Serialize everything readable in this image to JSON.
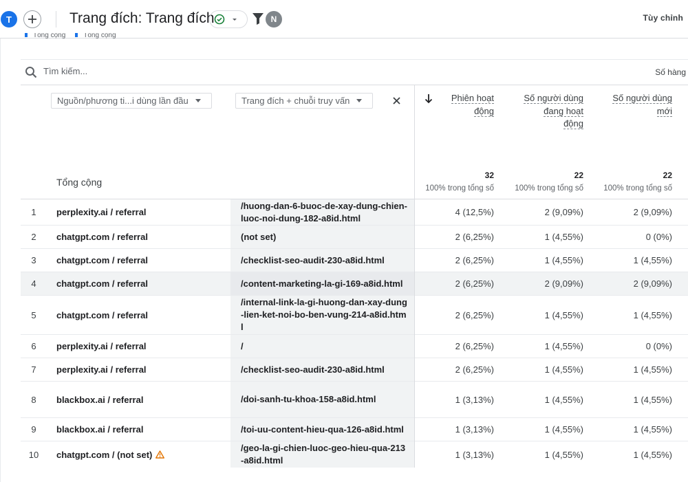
{
  "header": {
    "avatar_initial": "T",
    "title": "Trang đích: Trang đích",
    "filter_avatar_initial": "N",
    "customize_label": "Tùy chỉnh"
  },
  "legend_peek": [
    "Tổng cộng",
    "Tổng cộng"
  ],
  "search": {
    "placeholder": "Tìm kiếm...",
    "rows_label": "Số hàng"
  },
  "table": {
    "dimension_1": "Nguồn/phương ti...i dùng lần đầu",
    "dimension_2": "Trang đích + chuỗi truy vấn",
    "total_label": "Tổng cộng",
    "metrics": [
      {
        "line1": "Phiên hoạt",
        "line2": "động",
        "line3": "",
        "total": "32",
        "total_sub": "100% trong tổng số"
      },
      {
        "line1": "Số người dùng",
        "line2": "đang hoạt",
        "line3": "động",
        "total": "22",
        "total_sub": "100% trong tổng số"
      },
      {
        "line1": "Số người dùng",
        "line2": "mới",
        "line3": "",
        "total": "22",
        "total_sub": "100% trong tổng số"
      }
    ],
    "rows": [
      {
        "num": "1",
        "source": "perplexity.ai / referral",
        "page": "/huong-dan-6-buoc-de-xay-dung-chien-luoc-noi-dung-182-a8id.html",
        "m1": "4 (12,5%)",
        "m2": "2 (9,09%)",
        "m3": "2 (9,09%)"
      },
      {
        "num": "2",
        "source": "chatgpt.com / referral",
        "page": "(not set)",
        "m1": "2 (6,25%)",
        "m2": "1 (4,55%)",
        "m3": "0 (0%)"
      },
      {
        "num": "3",
        "source": "chatgpt.com / referral",
        "page": "/checklist-seo-audit-230-a8id.html",
        "m1": "2 (6,25%)",
        "m2": "1 (4,55%)",
        "m3": "1 (4,55%)"
      },
      {
        "num": "4",
        "source": "chatgpt.com / referral",
        "page": "/content-marketing-la-gi-169-a8id.html",
        "m1": "2 (6,25%)",
        "m2": "2 (9,09%)",
        "m3": "2 (9,09%)"
      },
      {
        "num": "5",
        "source": "chatgpt.com / referral",
        "page": "/internal-link-la-gi-huong-dan-xay-dung-lien-ket-noi-bo-ben-vung-214-a8id.html",
        "m1": "2 (6,25%)",
        "m2": "1 (4,55%)",
        "m3": "1 (4,55%)"
      },
      {
        "num": "6",
        "source": "perplexity.ai / referral",
        "page": "/",
        "m1": "2 (6,25%)",
        "m2": "1 (4,55%)",
        "m3": "0 (0%)"
      },
      {
        "num": "7",
        "source": "perplexity.ai / referral",
        "page": "/checklist-seo-audit-230-a8id.html",
        "m1": "2 (6,25%)",
        "m2": "1 (4,55%)",
        "m3": "1 (4,55%)"
      },
      {
        "num": "8",
        "source": "blackbox.ai / referral",
        "page": "/doi-sanh-tu-khoa-158-a8id.html",
        "m1": "1 (3,13%)",
        "m2": "1 (4,55%)",
        "m3": "1 (4,55%)"
      },
      {
        "num": "9",
        "source": "blackbox.ai / referral",
        "page": "/toi-uu-content-hieu-qua-126-a8id.html",
        "m1": "1 (3,13%)",
        "m2": "1 (4,55%)",
        "m3": "1 (4,55%)"
      },
      {
        "num": "10",
        "source": "chatgpt.com / (not set)",
        "page": "/geo-la-gi-chien-luoc-geo-hieu-qua-213-a8id.html",
        "m1": "1 (3,13%)",
        "m2": "1 (4,55%)",
        "m3": "1 (4,55%)",
        "warning": true
      }
    ]
  }
}
